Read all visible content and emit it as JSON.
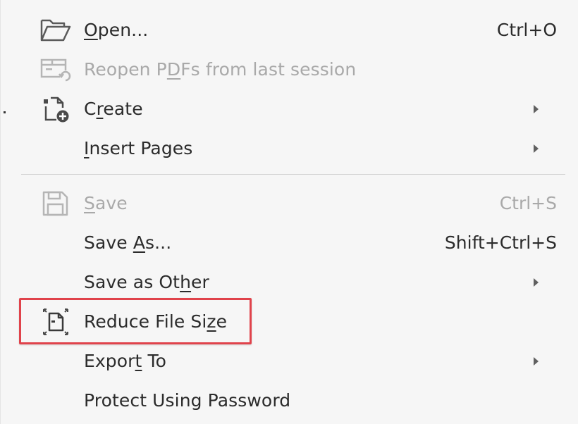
{
  "menu": {
    "items": [
      {
        "label_pre": "",
        "label_u": "O",
        "label_post": "pen...",
        "shortcut": "Ctrl+O",
        "icon": "folder-open-icon"
      },
      {
        "label_pre": "Reopen P",
        "label_u": "D",
        "label_post": "Fs from last session",
        "shortcut": "",
        "icon": "reopen-session-icon"
      },
      {
        "label_pre": "C",
        "label_u": "r",
        "label_post": "eate",
        "shortcut": "",
        "icon": "create-pdf-icon"
      },
      {
        "label_pre": "",
        "label_u": "I",
        "label_post": "nsert Pages",
        "shortcut": "",
        "icon": ""
      },
      {
        "label_pre": "",
        "label_u": "S",
        "label_post": "ave",
        "shortcut": "Ctrl+S",
        "icon": "save-icon"
      },
      {
        "label_pre": "Save ",
        "label_u": "A",
        "label_post": "s...",
        "shortcut": "Shift+Ctrl+S",
        "icon": ""
      },
      {
        "label_pre": "Save as Ot",
        "label_u": "h",
        "label_post": "er",
        "shortcut": "",
        "icon": ""
      },
      {
        "label_pre": "Reduce File Si",
        "label_u": "z",
        "label_post": "e",
        "shortcut": "",
        "icon": "reduce-file-size-icon"
      },
      {
        "label_pre": "Expor",
        "label_u": "t",
        "label_post": " To",
        "shortcut": "",
        "icon": ""
      },
      {
        "label_pre": "Protect Using Password",
        "label_u": "",
        "label_post": "",
        "shortcut": "",
        "icon": ""
      }
    ]
  },
  "colors": {
    "highlight": "#e0434b",
    "disabled_text": "#a9a9a9",
    "text": "#2b2b2b",
    "background": "#f6f6f6"
  }
}
